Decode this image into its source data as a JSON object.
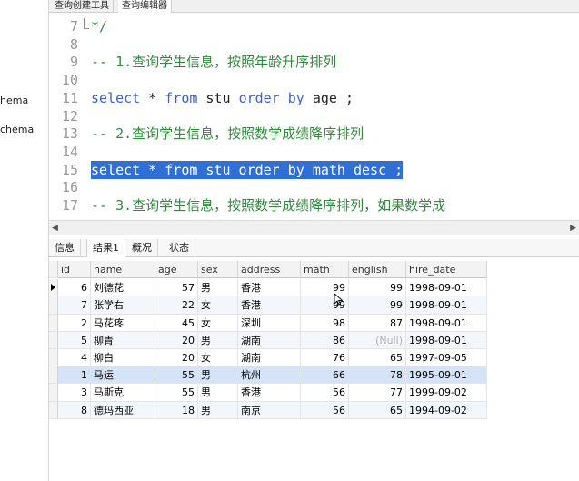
{
  "left_panel": {
    "items": [
      "hema",
      "chema"
    ]
  },
  "query_tabs": [
    "查询创建工具",
    "查询编辑器"
  ],
  "editor": {
    "lines": [
      {
        "num": "7",
        "tokens": [
          {
            "t": "*/",
            "c": "cmt"
          }
        ]
      },
      {
        "num": "8",
        "tokens": []
      },
      {
        "num": "9",
        "tokens": [
          {
            "t": "-- 1.查询学生信息，按照年龄升序排列",
            "c": "cmt"
          }
        ]
      },
      {
        "num": "10",
        "tokens": []
      },
      {
        "num": "11",
        "tokens": [
          {
            "t": "select",
            "c": "kw"
          },
          {
            "t": " * ",
            "c": "plain"
          },
          {
            "t": "from",
            "c": "kw"
          },
          {
            "t": " stu ",
            "c": "plain"
          },
          {
            "t": "order by",
            "c": "kw"
          },
          {
            "t": " age ;",
            "c": "plain"
          }
        ]
      },
      {
        "num": "12",
        "tokens": []
      },
      {
        "num": "13",
        "tokens": [
          {
            "t": "-- 2.查询学生信息，按照数学成绩降序排列",
            "c": "cmt"
          }
        ]
      },
      {
        "num": "14",
        "tokens": []
      },
      {
        "num": "15",
        "selected": true,
        "tokens": [
          {
            "t": "select * from stu order by math desc ;",
            "c": "plain"
          }
        ]
      },
      {
        "num": "16",
        "tokens": []
      },
      {
        "num": "17",
        "tokens": [
          {
            "t": "-- 3.查询学生信息，按照数学成绩降序排列，如果数学成",
            "c": "cmt"
          }
        ]
      }
    ]
  },
  "result_tabs": [
    "信息",
    "结果1",
    "概况",
    "状态"
  ],
  "grid": {
    "columns": [
      "id",
      "name",
      "age",
      "sex",
      "address",
      "math",
      "english",
      "hire_date"
    ],
    "rows": [
      [
        "6",
        "刘德花",
        "57",
        "男",
        "香港",
        "99",
        "99",
        "1998-09-01"
      ],
      [
        "7",
        "张学右",
        "22",
        "女",
        "香港",
        "99",
        "99",
        "1998-09-01"
      ],
      [
        "2",
        "马花疼",
        "45",
        "女",
        "深圳",
        "98",
        "87",
        "1998-09-01"
      ],
      [
        "5",
        "柳青",
        "20",
        "男",
        "湖南",
        "86",
        "(Null)",
        "1998-09-01"
      ],
      [
        "4",
        "柳白",
        "20",
        "女",
        "湖南",
        "76",
        "65",
        "1997-09-05"
      ],
      [
        "1",
        "马运",
        "55",
        "男",
        "杭州",
        "66",
        "78",
        "1995-09-01"
      ],
      [
        "3",
        "马斯克",
        "55",
        "男",
        "香港",
        "56",
        "77",
        "1999-09-02"
      ],
      [
        "8",
        "德玛西亚",
        "18",
        "男",
        "南京",
        "56",
        "65",
        "1994-09-02"
      ]
    ]
  }
}
